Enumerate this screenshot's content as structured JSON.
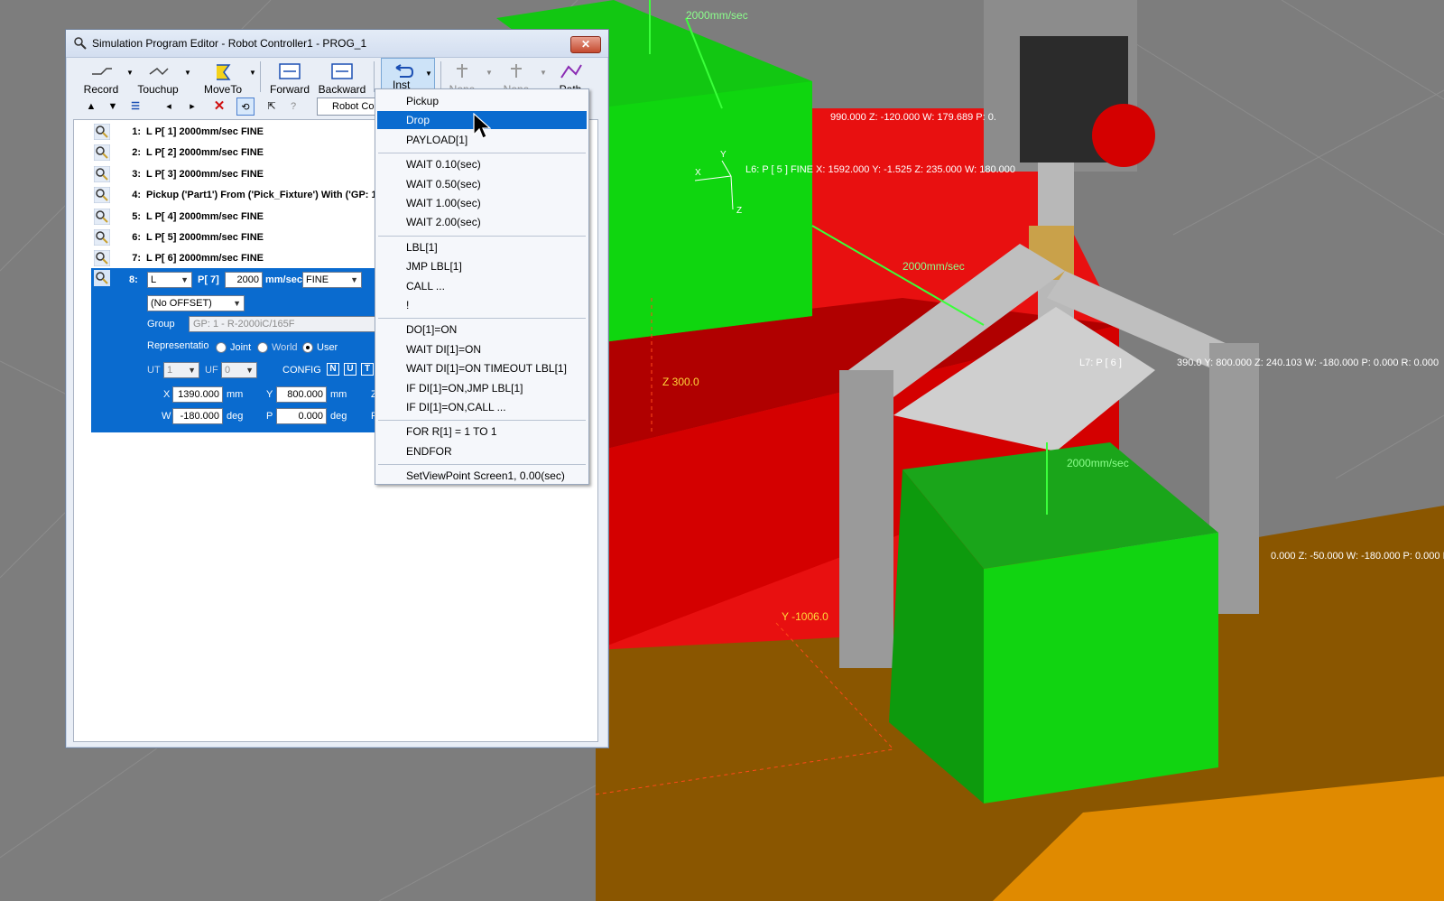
{
  "window": {
    "title": "Simulation Program Editor - Robot Controller1 - PROG_1",
    "close_label": "✕"
  },
  "toolbar": {
    "record": "Record",
    "touchup": "Touchup",
    "moveto": "MoveTo",
    "forward": "Forward",
    "backward": "Backward",
    "inst": "Inst",
    "none1": "None",
    "none2": "None",
    "path": "Path",
    "robot_combo": "Robot Con"
  },
  "program": {
    "lines": [
      {
        "num": "1:",
        "text": "L P[ 1] 2000mm/sec FINE"
      },
      {
        "num": "2:",
        "text": "L P[ 2] 2000mm/sec FINE"
      },
      {
        "num": "3:",
        "text": "L P[ 3] 2000mm/sec FINE"
      },
      {
        "num": "4:",
        "text": "Pickup ('Part1') From ('Pick_Fixture') With ('GP: 1"
      },
      {
        "num": "5:",
        "text": "L P[ 4] 2000mm/sec FINE"
      },
      {
        "num": "6:",
        "text": "L P[ 5] 2000mm/sec FINE"
      },
      {
        "num": "7:",
        "text": "L P[ 6] 2000mm/sec FINE"
      }
    ],
    "selected": {
      "num": "8:",
      "motion_type": "L",
      "point": "P[ 7]",
      "speed": "2000",
      "speed_unit": "mm/sec",
      "termination": "FINE",
      "offset": "(No OFFSET)",
      "group_label": "Group",
      "group_value": "GP: 1 - R-2000iC/165F",
      "representation_label": "Representatio",
      "rep_joint": "Joint",
      "rep_world": "World",
      "rep_user": "User",
      "ut_label": "UT",
      "ut_value": "1",
      "uf_label": "UF",
      "uf_value": "0",
      "config_label": "CONFIG",
      "config_n": "N",
      "config_u": "U",
      "config_t": "T",
      "x_label": "X",
      "x_value": "1390.000",
      "x_unit": "mm",
      "y_label": "Y",
      "y_value": "800.000",
      "y_unit": "mm",
      "z_label": "Z",
      "w_label": "W",
      "w_value": "-180.000",
      "w_unit": "deg",
      "p_label": "P",
      "p_value": "0.000",
      "p_unit": "deg",
      "r_label": "R"
    }
  },
  "inst_menu": {
    "items": [
      "Pickup",
      "Drop",
      "PAYLOAD[1]",
      "WAIT 0.10(sec)",
      "WAIT 0.50(sec)",
      "WAIT 1.00(sec)",
      "WAIT 2.00(sec)",
      "LBL[1]",
      "JMP LBL[1]",
      "CALL ...",
      "!",
      "DO[1]=ON",
      "WAIT DI[1]=ON",
      "WAIT DI[1]=ON TIMEOUT LBL[1]",
      "IF DI[1]=ON,JMP LBL[1]",
      "IF DI[1]=ON,CALL ...",
      "FOR R[1] = 1 TO 1",
      "ENDFOR",
      "SetViewPoint  Screen1, 0.00(sec)"
    ],
    "highlighted": "Drop"
  },
  "scene_labels": {
    "speed_top": "2000mm/sec",
    "pos_top_right": "990.000 Z: -120.000 W: 179.689 P: 0.",
    "pos_l6": "L6: P [ 5 ]  FINE X: 1592.000 Y: -1.525 Z: 235.000 W: 180.000",
    "speed_mid": "2000mm/sec",
    "z_label": "Z 300.0",
    "pos_l7": "L7: P [ 6 ]",
    "pos_mid_right": "390.0  Y: 800.000 Z: 240.103 W: -180.000 P: 0.000 R: 0.000",
    "speed_low": "2000mm/sec",
    "pos_low_right": "0.000 Z: -50.000 W: -180.000 P: 0.000 R: 0.000",
    "y_label": "Y -1006.0",
    "axis_x": "X",
    "axis_y": "Y",
    "axis_z": "Z"
  },
  "colors": {
    "selection": "#0a6bcf",
    "green_box": "#12c712",
    "red_box": "#e81010",
    "floor": "#8a5600"
  }
}
